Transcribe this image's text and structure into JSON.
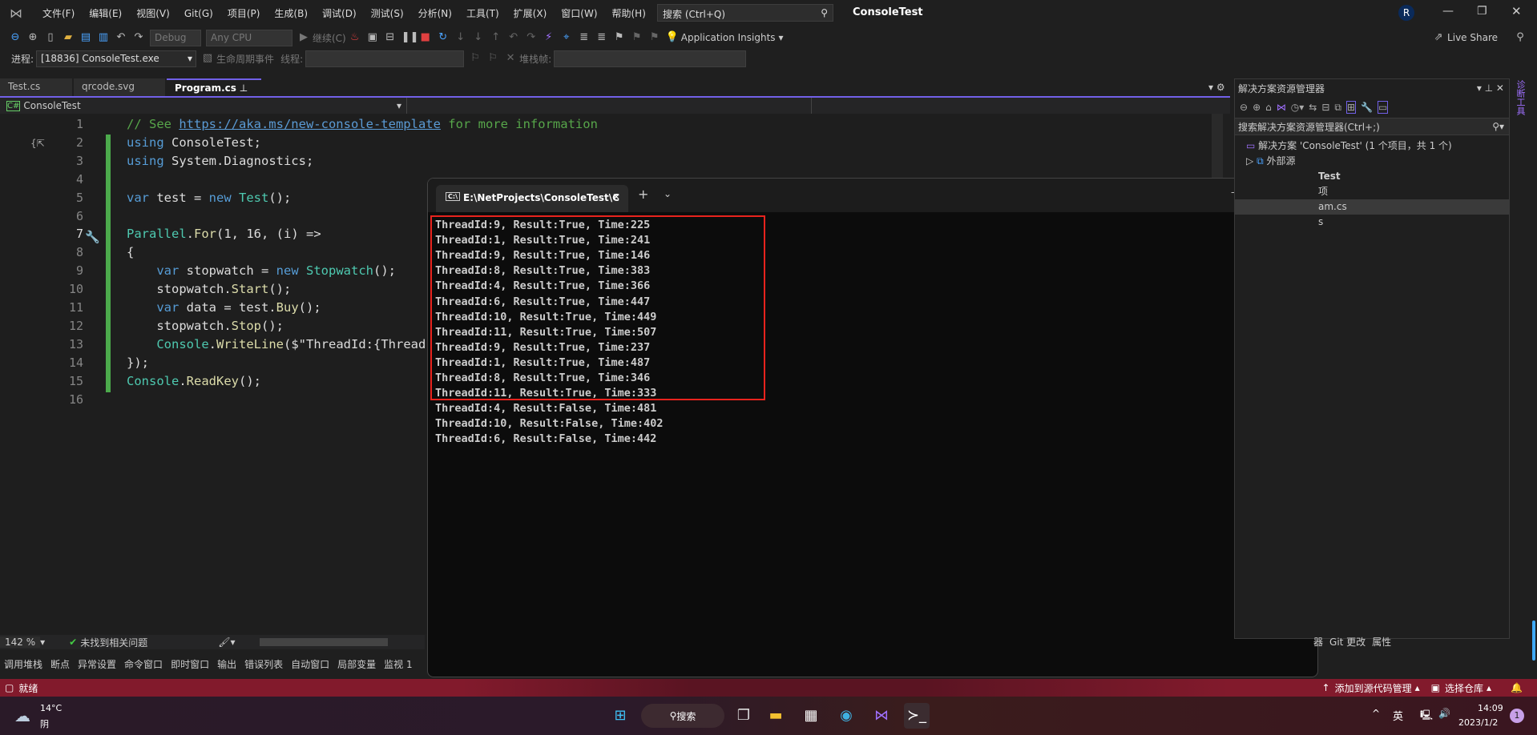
{
  "app": {
    "title": "ConsoleTest",
    "menu": [
      "文件(F)",
      "编辑(E)",
      "视图(V)",
      "Git(G)",
      "项目(P)",
      "生成(B)",
      "调试(D)",
      "测试(S)",
      "分析(N)",
      "工具(T)",
      "扩展(X)",
      "窗口(W)",
      "帮助(H)"
    ],
    "search_placeholder": "搜索 (Ctrl+Q)",
    "avatar": "R",
    "accent": "#7160e8"
  },
  "toolbar": {
    "config": "Debug",
    "platform": "Any CPU",
    "continue": "继续(C)",
    "app_insights": "Application Insights",
    "live_share": "Live Share",
    "process_label": "进程:",
    "process": "[18836] ConsoleTest.exe",
    "lifecycle": "生命周期事件",
    "thread_label": "线程:",
    "stack_label": "堆栈帧:"
  },
  "tabs": [
    {
      "label": "Test.cs"
    },
    {
      "label": "qrcode.svg"
    },
    {
      "label": "Program.cs",
      "active": true
    }
  ],
  "navbar": {
    "project": "ConsoleTest"
  },
  "editor": {
    "zoom": "142 %",
    "issues": "未找到相关问题",
    "current_line": 7,
    "lines": [
      [
        [
          "// See ",
          "cm"
        ],
        [
          "https://aka.ms/new-console-template",
          "lk"
        ],
        [
          " for more information",
          "cm"
        ]
      ],
      [
        [
          "using",
          "kw"
        ],
        [
          " ConsoleTest;",
          ""
        ]
      ],
      [
        [
          "using",
          "kw"
        ],
        [
          " System.Diagnostics;",
          ""
        ]
      ],
      [],
      [
        [
          "var",
          "kw"
        ],
        [
          " test = ",
          ""
        ],
        [
          "new",
          "kw"
        ],
        [
          " ",
          ""
        ],
        [
          "Test",
          "ty"
        ],
        [
          "();",
          ""
        ]
      ],
      [],
      [
        [
          "Parallel",
          "ty"
        ],
        [
          ".",
          ""
        ],
        [
          "For",
          "fn"
        ],
        [
          "(1, 16, (i) =>",
          ""
        ]
      ],
      [
        [
          "{",
          ""
        ]
      ],
      [
        [
          "    ",
          ""
        ],
        [
          "var",
          "kw"
        ],
        [
          " stopwatch = ",
          ""
        ],
        [
          "new",
          "kw"
        ],
        [
          " ",
          ""
        ],
        [
          "Stopwatch",
          "ty"
        ],
        [
          "();",
          ""
        ]
      ],
      [
        [
          "    stopwatch.",
          ""
        ],
        [
          "Start",
          "fn"
        ],
        [
          "();",
          ""
        ]
      ],
      [
        [
          "    ",
          ""
        ],
        [
          "var",
          "kw"
        ],
        [
          " data = test.",
          ""
        ],
        [
          "Buy",
          "fn"
        ],
        [
          "();",
          ""
        ]
      ],
      [
        [
          "    stopwatch.",
          ""
        ],
        [
          "Stop",
          "fn"
        ],
        [
          "();",
          ""
        ]
      ],
      [
        [
          "    ",
          ""
        ],
        [
          "Console",
          "ty"
        ],
        [
          ".",
          ""
        ],
        [
          "WriteLine",
          "fn"
        ],
        [
          "(",
          ""
        ],
        [
          "$\"ThreadId:",
          ""
        ],
        [
          "{Thread.",
          ""
        ]
      ],
      [
        [
          "});",
          ""
        ]
      ],
      [
        [
          "Console",
          "ty"
        ],
        [
          ".",
          ""
        ],
        [
          "ReadKey",
          "fn"
        ],
        [
          "();",
          ""
        ]
      ],
      []
    ]
  },
  "console": {
    "title": "E:\\NetProjects\\ConsoleTest\\C",
    "lines": [
      "ThreadId:9, Result:True, Time:225",
      "ThreadId:1, Result:True, Time:241",
      "ThreadId:9, Result:True, Time:146",
      "ThreadId:8, Result:True, Time:383",
      "ThreadId:4, Result:True, Time:366",
      "ThreadId:6, Result:True, Time:447",
      "ThreadId:10, Result:True, Time:449",
      "ThreadId:11, Result:True, Time:507",
      "ThreadId:9, Result:True, Time:237",
      "ThreadId:1, Result:True, Time:487",
      "ThreadId:8, Result:True, Time:346",
      "ThreadId:11, Result:True, Time:333",
      "ThreadId:4, Result:False, Time:481",
      "ThreadId:10, Result:False, Time:402",
      "ThreadId:6, Result:False, Time:442"
    ],
    "highlight_color": "#e8231d"
  },
  "solution": {
    "title": "解决方案资源管理器",
    "search": "搜索解决方案资源管理器(Ctrl+;)",
    "items": [
      "解决方案 'ConsoleTest' (1 个项目，共 1 个)",
      "外部源",
      "Test",
      "项",
      "am.cs",
      "s"
    ],
    "side_label": "诊断工具",
    "bottom_tabs": [
      "器",
      "Git 更改",
      "属性"
    ]
  },
  "bottom_tabs": [
    "调用堆栈",
    "断点",
    "异常设置",
    "命令窗口",
    "即时窗口",
    "输出",
    "错误列表",
    "自动窗口",
    "局部变量",
    "监视 1"
  ],
  "status": {
    "ready": "就绪",
    "source_control": "添加到源代码管理",
    "repo": "选择仓库"
  },
  "taskbar": {
    "temp": "14°C",
    "weather": "阴",
    "search": "搜索",
    "ime": "英",
    "time": "14:09",
    "date": "2023/1/2",
    "badge": "1"
  }
}
